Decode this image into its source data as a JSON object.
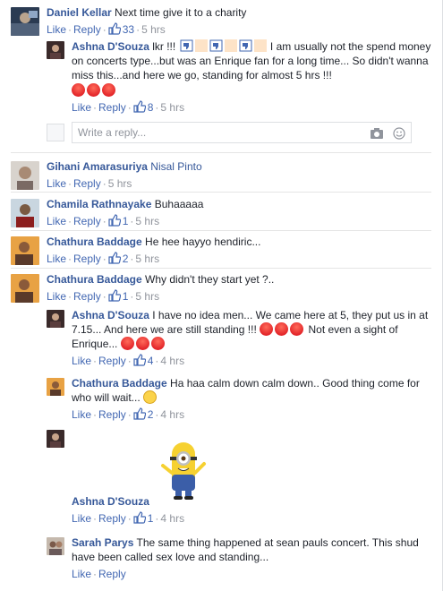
{
  "comments": [
    {
      "name": "Daniel Kellar",
      "text": "Next time give it to a charity",
      "like": "Like",
      "reply": "Reply",
      "likes": "33",
      "time": "5 hrs"
    },
    {
      "name": "Ashna D'Souza",
      "text_a": "lkr !!!",
      "text_b": "I am usually not the spend money on concerts type...but was an Enrique fan for a long time... So didn't wanna miss this...and here we go, standing for almost 5 hrs !!!",
      "like": "Like",
      "reply": "Reply",
      "likes": "8",
      "time": "5 hrs"
    },
    {
      "name": "Gihani Amarasuriya",
      "mention": "Nisal Pinto",
      "like": "Like",
      "reply": "Reply",
      "time": "5 hrs"
    },
    {
      "name": "Chamila Rathnayake",
      "text": "Buhaaaaa",
      "like": "Like",
      "reply": "Reply",
      "likes": "1",
      "time": "5 hrs"
    },
    {
      "name": "Chathura Baddage",
      "text": "He hee hayyo hendiric...",
      "like": "Like",
      "reply": "Reply",
      "likes": "2",
      "time": "5 hrs"
    },
    {
      "name": "Chathura Baddage",
      "text": "Why didn't they start yet ?..",
      "like": "Like",
      "reply": "Reply",
      "likes": "1",
      "time": "5 hrs"
    },
    {
      "name": "Ashna D'Souza",
      "text_a": "I have no idea men... We came here at 5, they put us in at 7.15... And here we are still standing !!!",
      "text_b": "Not even a sight of Enrique...",
      "like": "Like",
      "reply": "Reply",
      "likes": "4",
      "time": "4 hrs"
    },
    {
      "name": "Chathura Baddage",
      "text": "Ha haa calm down calm down.. Good thing come for who will wait...",
      "like": "Like",
      "reply": "Reply",
      "likes": "2",
      "time": "4 hrs"
    },
    {
      "name": "Ashna D'Souza",
      "like": "Like",
      "reply": "Reply",
      "likes": "1",
      "time": "4 hrs"
    },
    {
      "name": "Sarah Parys",
      "text": "The same thing happened at sean pauls concert. This shud have been called sex love and standing...",
      "like": "Like",
      "reply": "Reply"
    }
  ],
  "write_reply": {
    "placeholder": "Write a reply..."
  },
  "icons": {
    "like": "thumbs-up-icon",
    "camera": "camera-icon",
    "emoji": "smiley-icon",
    "angry": "angry-face-icon"
  },
  "colors": {
    "name": "#365899",
    "action": "#4267b2",
    "meta": "#90949c",
    "text": "#1d2129"
  }
}
